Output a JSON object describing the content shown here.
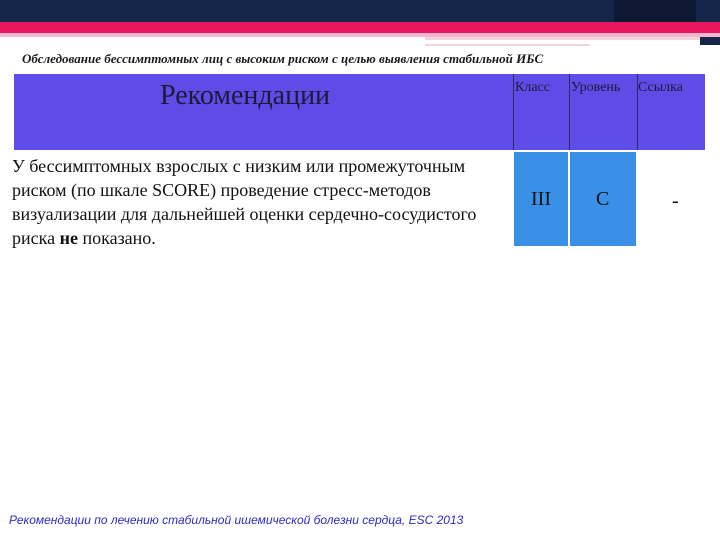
{
  "slide": {
    "title": "Обследование бессимптомных лиц с высоким риском с целью выявления стабильной ИБС",
    "footer": "Рекомендации по лечению стабильной ишемической болезни сердца, ESC 2013"
  },
  "table": {
    "header": {
      "recommendations": "Рекомендации",
      "class": "Класс",
      "level": "Уровень",
      "reference": "Ссылка"
    },
    "rows": [
      {
        "text_before": "У бессимптомных взрослых с низким или промежуточным риском (по шкале SCORE) проведение стресс-методов визуализации для дальнейшей оценки сердечно-сосудистого риска ",
        "text_strong": "не",
        "text_after": " показано.",
        "class": "III",
        "level": "C",
        "reference": "-"
      }
    ]
  },
  "colors": {
    "header_band": "#5e4ce6",
    "cell_highlight": "#3a8fe6",
    "top_bar": "#16254a",
    "accent_bar": "#e8175d",
    "footer_text": "#2a2ac8"
  }
}
